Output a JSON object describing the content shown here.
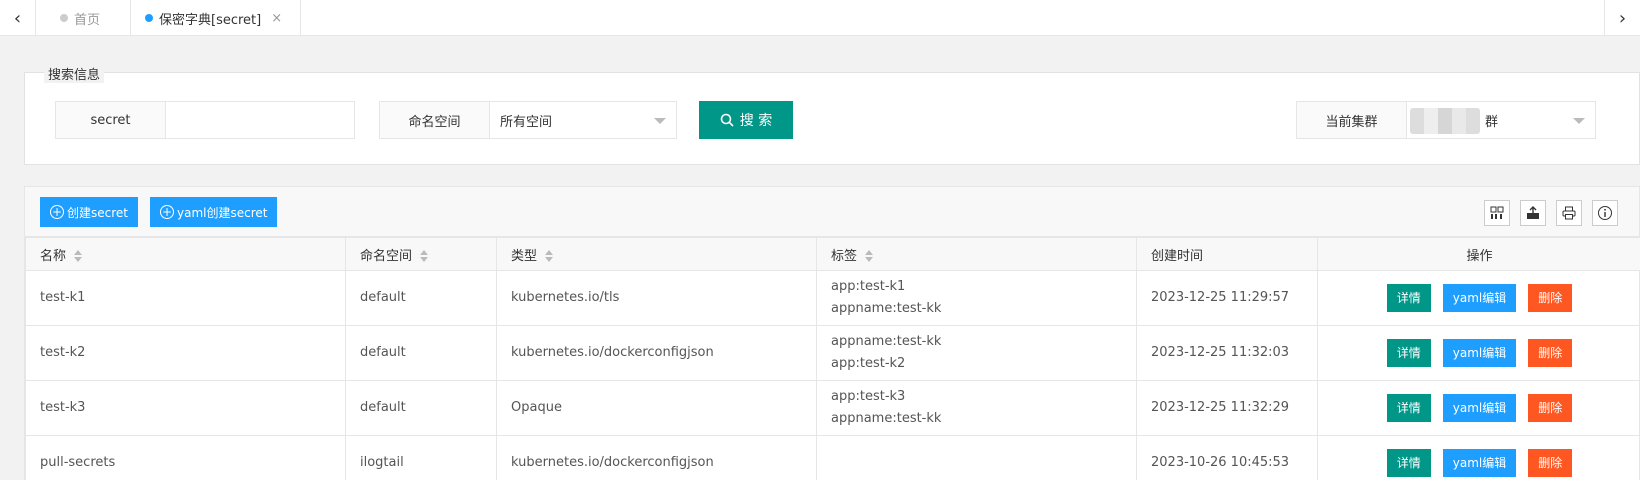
{
  "tabs": {
    "home": "首页",
    "active": "保密字典[secret]",
    "close": "×"
  },
  "search": {
    "legend": "搜索信息",
    "secret_label": "secret",
    "secret_value": "",
    "namespace_label": "命名空间",
    "namespace_value": "所有空间",
    "search_button": "搜 索",
    "cluster_label": "当前集群",
    "cluster_value": "群"
  },
  "toolbar": {
    "create_secret": "创建secret",
    "yaml_create_secret": "yaml创建secret"
  },
  "table": {
    "headers": [
      "名称",
      "命名空间",
      "类型",
      "标签",
      "创建时间",
      "操作"
    ],
    "rows": [
      {
        "name": "test-k1",
        "namespace": "default",
        "type": "kubernetes.io/tls",
        "label1": "app:test-k1",
        "label2": "appname:test-kk",
        "created": "2023-12-25 11:29:57"
      },
      {
        "name": "test-k2",
        "namespace": "default",
        "type": "kubernetes.io/dockerconfigjson",
        "label1": "appname:test-kk",
        "label2": "app:test-k2",
        "created": "2023-12-25 11:32:03"
      },
      {
        "name": "test-k3",
        "namespace": "default",
        "type": "Opaque",
        "label1": "app:test-k3",
        "label2": "appname:test-kk",
        "created": "2023-12-25 11:32:29"
      },
      {
        "name": "pull-secrets",
        "namespace": "ilogtail",
        "type": "kubernetes.io/dockerconfigjson",
        "label1": "",
        "label2": "",
        "created": "2023-10-26 10:45:53"
      }
    ],
    "actions": {
      "detail": "详情",
      "yaml_edit": "yaml编辑",
      "delete": "删除"
    }
  },
  "colors": {
    "primary": "#009688",
    "blue": "#1e9fff",
    "danger": "#ff5722"
  },
  "icons": [
    "chevron-left-icon",
    "chevron-right-icon",
    "search-icon",
    "grid-columns-icon",
    "export-icon",
    "print-icon",
    "info-icon"
  ]
}
